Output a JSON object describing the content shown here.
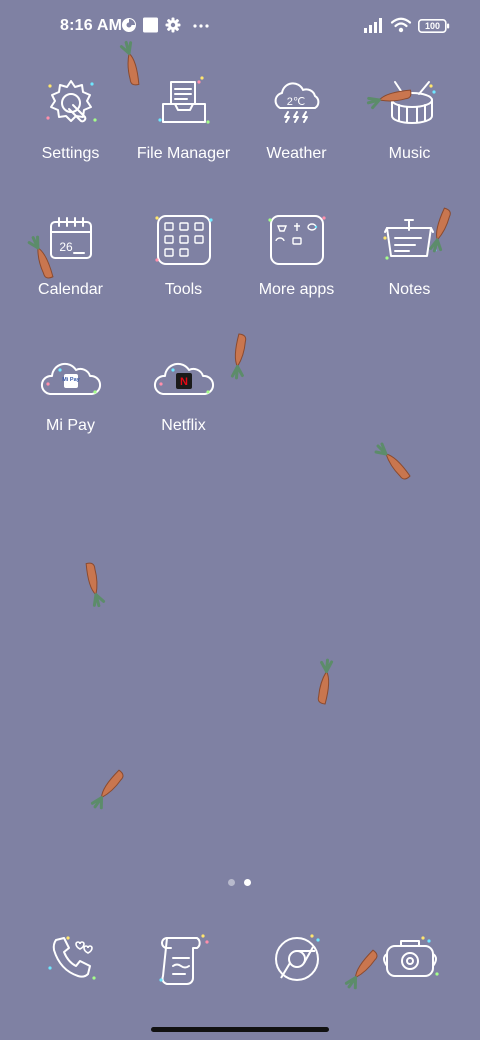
{
  "status_bar": {
    "time": "8:16 AM",
    "battery": "100",
    "icons": [
      "data-saver-icon",
      "square-notification-icon",
      "settings-gear-icon",
      "more-dots-icon",
      "signal-bars-icon",
      "wifi-icon",
      "battery-icon"
    ]
  },
  "apps": [
    {
      "label": "Settings",
      "icon": "settings-icon"
    },
    {
      "label": "File Manager",
      "icon": "file-manager-icon"
    },
    {
      "label": "Weather",
      "icon": "weather-icon",
      "icon_text": "2℃"
    },
    {
      "label": "Music",
      "icon": "music-drum-icon"
    },
    {
      "label": "Calendar",
      "icon": "calendar-icon",
      "icon_text": "26"
    },
    {
      "label": "Tools",
      "icon": "tools-folder-icon"
    },
    {
      "label": "More apps",
      "icon": "more-apps-folder-icon"
    },
    {
      "label": "Notes",
      "icon": "notes-icon"
    },
    {
      "label": "Mi Pay",
      "icon": "mi-pay-icon",
      "icon_text": "Mi Pay"
    },
    {
      "label": "Netflix",
      "icon": "netflix-icon",
      "icon_text": "N"
    }
  ],
  "page_indicator": {
    "pages": 2,
    "current": 2
  },
  "dock": [
    {
      "icon": "phone-icon"
    },
    {
      "icon": "messages-scroll-icon"
    },
    {
      "icon": "browser-icon"
    },
    {
      "icon": "camera-icon"
    }
  ],
  "colors": {
    "wallpaper": "#7f81a3",
    "carrot": "#c9764f",
    "carrot_leaf": "#5c8c6a",
    "netflix_red": "#e50914"
  }
}
